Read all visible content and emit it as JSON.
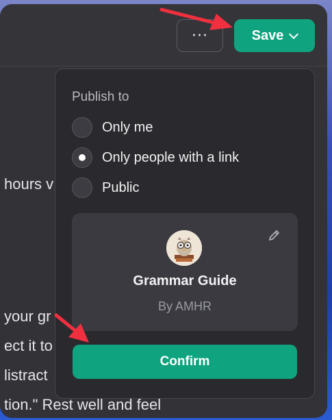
{
  "toolbar": {
    "more_label": "···",
    "save_label": "Save"
  },
  "background_lines": [
    "hours v",
    "your gr",
    "ect it to",
    "listract",
    "tion.\" Rest well and feel"
  ],
  "publish": {
    "heading": "Publish to",
    "options": [
      {
        "label": "Only me",
        "selected": false
      },
      {
        "label": "Only people with a link",
        "selected": true
      },
      {
        "label": "Public",
        "selected": false
      }
    ]
  },
  "gpt_card": {
    "name": "Grammar Guide",
    "author": "By AMHR"
  },
  "confirm_label": "Confirm",
  "colors": {
    "accent": "#10a37f",
    "annotation_arrow": "#f0303f"
  }
}
